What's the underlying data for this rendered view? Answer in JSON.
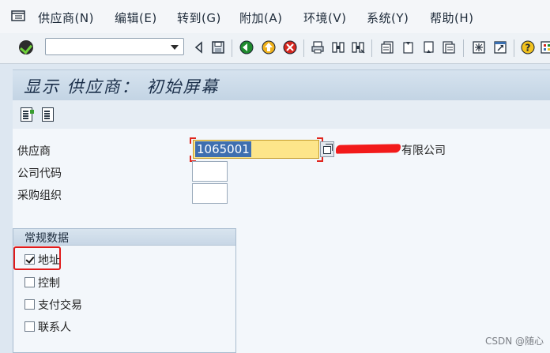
{
  "menu": {
    "items": [
      "供应商(N)",
      "编辑(E)",
      "转到(G)",
      "附加(A)",
      "环境(V)",
      "系统(Y)",
      "帮助(H)"
    ]
  },
  "toolbar": {
    "command_field_value": "",
    "icons": [
      "enter-icon",
      "back-arrow-icon",
      "save-icon",
      "back-icon",
      "exit-icon",
      "cancel-icon",
      "print-icon",
      "find-icon",
      "find-next-icon",
      "first-page-icon",
      "previous-page-icon",
      "next-page-icon",
      "last-page-icon",
      "new-session-icon",
      "shortcut-icon",
      "help-icon",
      "customize-layout-icon"
    ]
  },
  "screen": {
    "title": "显示 供应商： 初始屏幕"
  },
  "fields": {
    "vendor_label": "供应商",
    "vendor_value": "1065001",
    "vendor_description": "有限公司",
    "company_code_label": "公司代码",
    "company_code_value": "",
    "purch_org_label": "采购组织",
    "purch_org_value": ""
  },
  "general_data": {
    "title": "常规数据",
    "options": [
      {
        "label": "地址",
        "checked": true
      },
      {
        "label": "控制",
        "checked": false
      },
      {
        "label": "支付交易",
        "checked": false
      },
      {
        "label": "联系人",
        "checked": false
      }
    ]
  },
  "watermark": "CSDN @随心"
}
